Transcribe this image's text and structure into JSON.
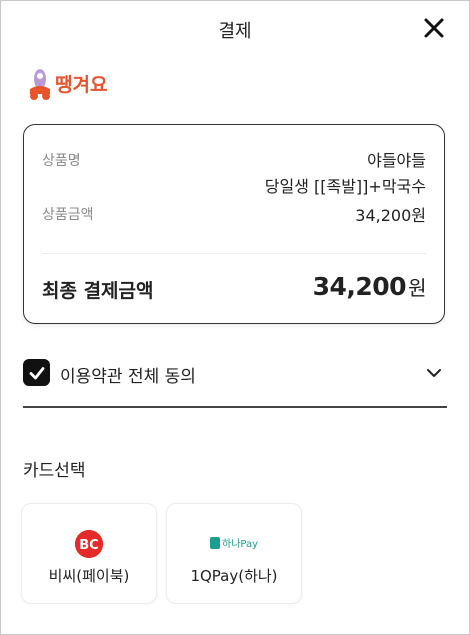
{
  "header": {
    "title": "결제"
  },
  "brand": {
    "logo_text": "땡겨요",
    "accent": "#e8532b"
  },
  "summary": {
    "product_name_label": "상품명",
    "product_name_line1": "야들야들",
    "product_name_line2": "당일생 [[족발]]+막국수",
    "product_amount_label": "상품금액",
    "product_amount_value": "34,200원",
    "total_label": "최종 결제금액",
    "total_amount": "34,200",
    "total_unit": "원"
  },
  "agreement": {
    "label": "이용약관 전체 동의",
    "checked": true
  },
  "card_section": {
    "title": "카드선택",
    "cards": [
      {
        "label": "비씨(페이북)",
        "icon": "bc-card-logo",
        "color": "#e52a2a"
      },
      {
        "label": "1QPay(하나)",
        "icon": "hana-pay-logo",
        "color": "#1a9e8f",
        "logo_text": "하나Pay"
      }
    ]
  }
}
